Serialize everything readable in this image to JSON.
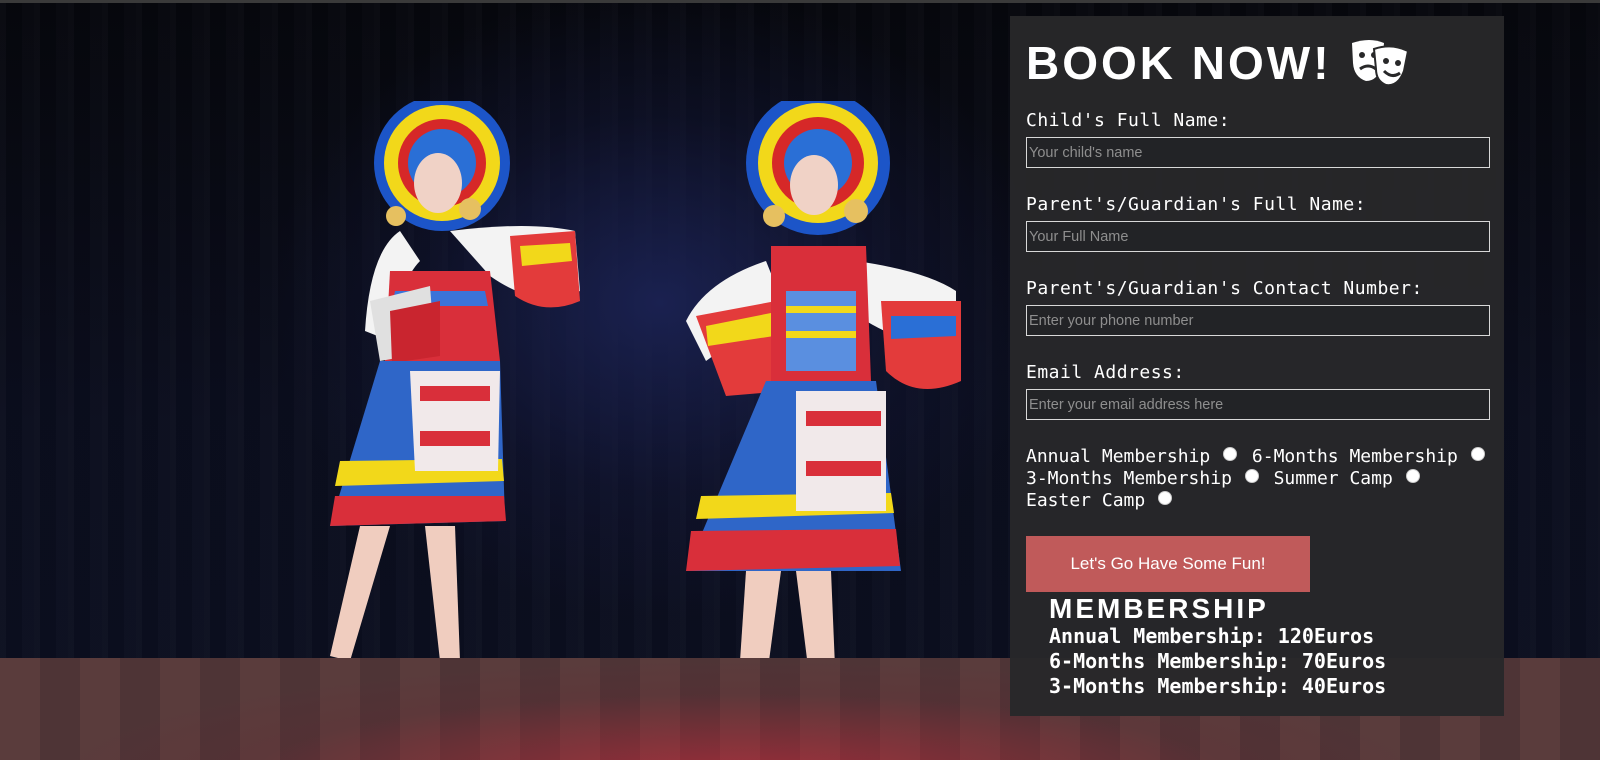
{
  "form": {
    "title": "BOOK NOW!",
    "title_icon": "theater-masks-icon",
    "fields": [
      {
        "label": "Child's Full Name:",
        "placeholder": "Your child's name"
      },
      {
        "label": "Parent's/Guardian's Full Name:",
        "placeholder": "Your Full Name"
      },
      {
        "label": "Parent's/Guardian's Contact Number:",
        "placeholder": "Enter your phone number"
      },
      {
        "label": "Email Address:",
        "placeholder": "Enter your email address here"
      }
    ],
    "options": [
      "Annual Membership",
      "6-Months Membership",
      "3-Months Membership",
      "Summer Camp",
      "Easter Camp"
    ],
    "submit_label": "Let's Go Have Some Fun!"
  },
  "membership": {
    "title": "MEMBERSHIP",
    "lines": [
      "Annual Membership: 120Euros",
      "6-Months Membership: 70Euros",
      "3-Months Membership: 40Euros"
    ]
  },
  "colors": {
    "panel_bg": "#282829",
    "button": "#c05a5a",
    "text": "#ffffff"
  }
}
